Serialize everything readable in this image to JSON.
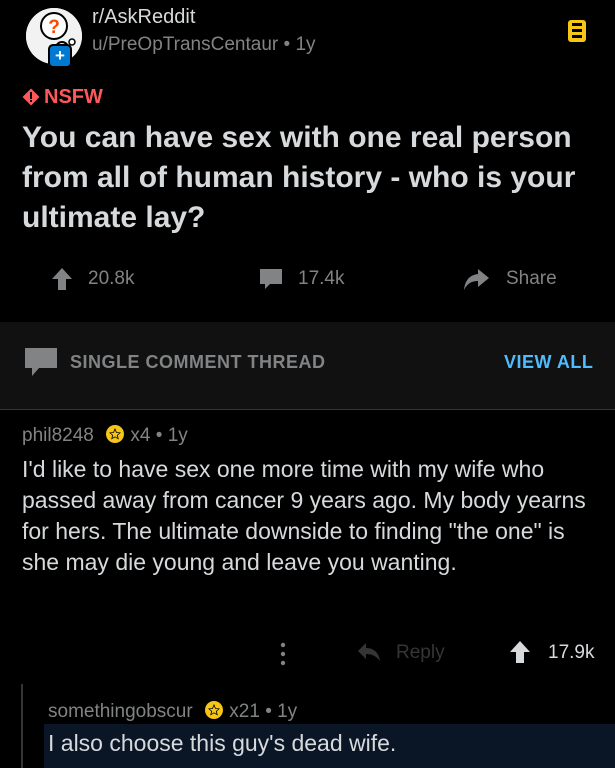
{
  "post": {
    "subreddit": "r/AskReddit",
    "author": "u/PreOpTransCentaur",
    "age_sep": "•",
    "age": "1y",
    "nsfw_label": "NSFW",
    "title": "You can have sex with one real person from all of human history - who is your ultimate lay?",
    "upvotes": "20.8k",
    "comments": "17.4k",
    "share_label": "Share",
    "icons": {
      "avatar": "askreddit-avatar-icon",
      "save": "save-icon",
      "nsfw": "nsfw-warning-icon"
    }
  },
  "thread_bar": {
    "label": "SINGLE COMMENT THREAD",
    "view_all": "VIEW ALL"
  },
  "comment": {
    "author": "phil8248",
    "award": "x4",
    "age": "• 1y",
    "body": "I'd like to have sex one more time with my wife who passed away from cancer 9 years ago. My body yearns for hers. The ultimate downside to finding \"the one\" is she may die young and leave you wanting.",
    "reply_label": "Reply",
    "votes": "17.9k"
  },
  "reply": {
    "author": "somethingobscur",
    "award": "x21",
    "age": "• 1y",
    "body": "I also choose this guy's dead wife."
  },
  "colors": {
    "nsfw": "#ff585b",
    "link": "#4fbcff",
    "award": "#f5c518",
    "background": "#000000"
  }
}
